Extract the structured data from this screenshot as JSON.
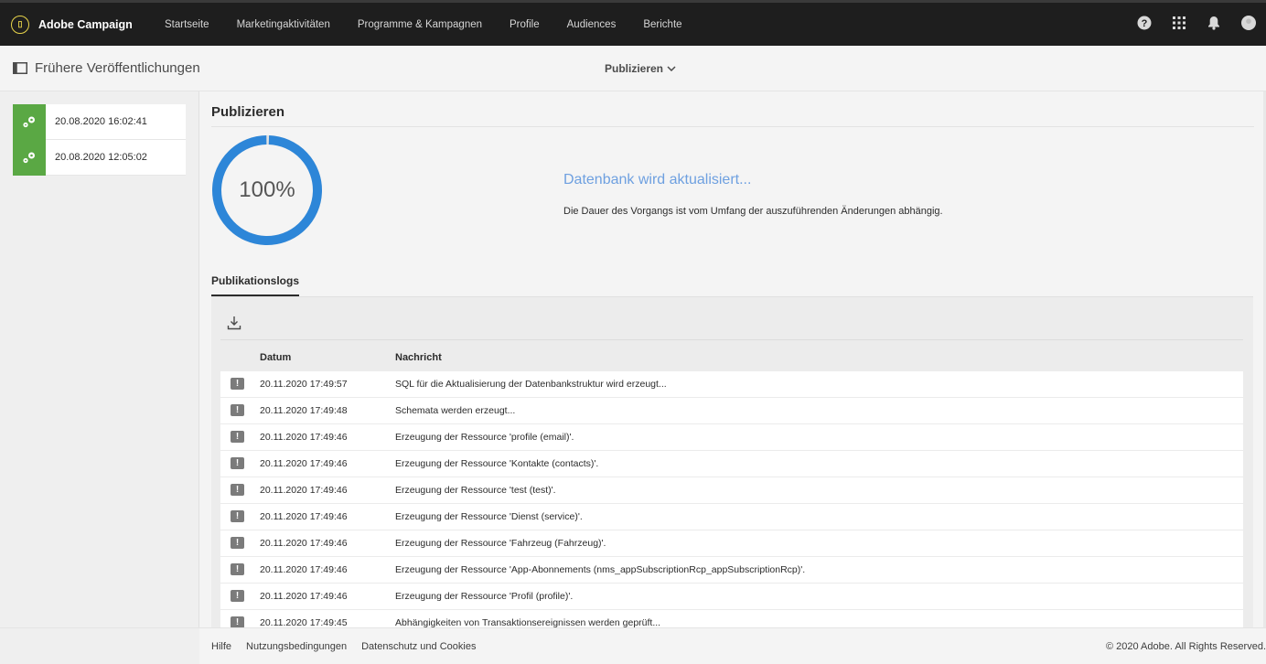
{
  "brand": {
    "name": "Adobe Campaign",
    "accent": "#e8d44a"
  },
  "nav": {
    "items": [
      {
        "label": "Startseite"
      },
      {
        "label": "Marketingaktivitäten"
      },
      {
        "label": "Programme & Kampagnen"
      },
      {
        "label": "Profile"
      },
      {
        "label": "Audiences"
      },
      {
        "label": "Berichte"
      }
    ],
    "right_icons": [
      "help-icon",
      "apps-grid-icon",
      "bell-icon",
      "user-avatar-icon"
    ]
  },
  "subheader": {
    "left_title": "Frühere Veröffentlichungen",
    "center_menu": "Publizieren"
  },
  "previous_publications": [
    {
      "date": "20.08.2020 16:02:41"
    },
    {
      "date": "20.08.2020 12:05:02"
    }
  ],
  "main": {
    "title": "Publizieren",
    "progress_percent": 100,
    "progress_label": "100%",
    "progress_color": "#2d86d8",
    "status_title": "Datenbank wird aktualisiert...",
    "status_description": "Die Dauer des Vorgangs ist vom Umfang der auszuführenden Änderungen abhängig."
  },
  "logs": {
    "tab_label": "Publikationslogs",
    "columns": {
      "date": "Datum",
      "message": "Nachricht"
    },
    "rows": [
      {
        "date": "20.11.2020 17:49:57",
        "message": "SQL für die Aktualisierung der Datenbankstruktur wird erzeugt..."
      },
      {
        "date": "20.11.2020 17:49:48",
        "message": "Schemata werden erzeugt..."
      },
      {
        "date": "20.11.2020 17:49:46",
        "message": "Erzeugung der Ressource 'profile (email)'."
      },
      {
        "date": "20.11.2020 17:49:46",
        "message": "Erzeugung der Ressource 'Kontakte (contacts)'."
      },
      {
        "date": "20.11.2020 17:49:46",
        "message": "Erzeugung der Ressource 'test (test)'."
      },
      {
        "date": "20.11.2020 17:49:46",
        "message": "Erzeugung der Ressource 'Dienst (service)'."
      },
      {
        "date": "20.11.2020 17:49:46",
        "message": "Erzeugung der Ressource 'Fahrzeug (Fahrzeug)'."
      },
      {
        "date": "20.11.2020 17:49:46",
        "message": "Erzeugung der Ressource 'App-Abonnements (nms_appSubscriptionRcp_appSubscriptionRcp)'."
      },
      {
        "date": "20.11.2020 17:49:46",
        "message": "Erzeugung der Ressource 'Profil (profile)'."
      },
      {
        "date": "20.11.2020 17:49:45",
        "message": "Abhängigkeiten von Transaktionsereignissen werden geprüft..."
      }
    ]
  },
  "footer": {
    "links": [
      "Hilfe",
      "Nutzungsbedingungen",
      "Datenschutz und Cookies"
    ],
    "copyright": "© 2020 Adobe. All Rights Reserved."
  }
}
